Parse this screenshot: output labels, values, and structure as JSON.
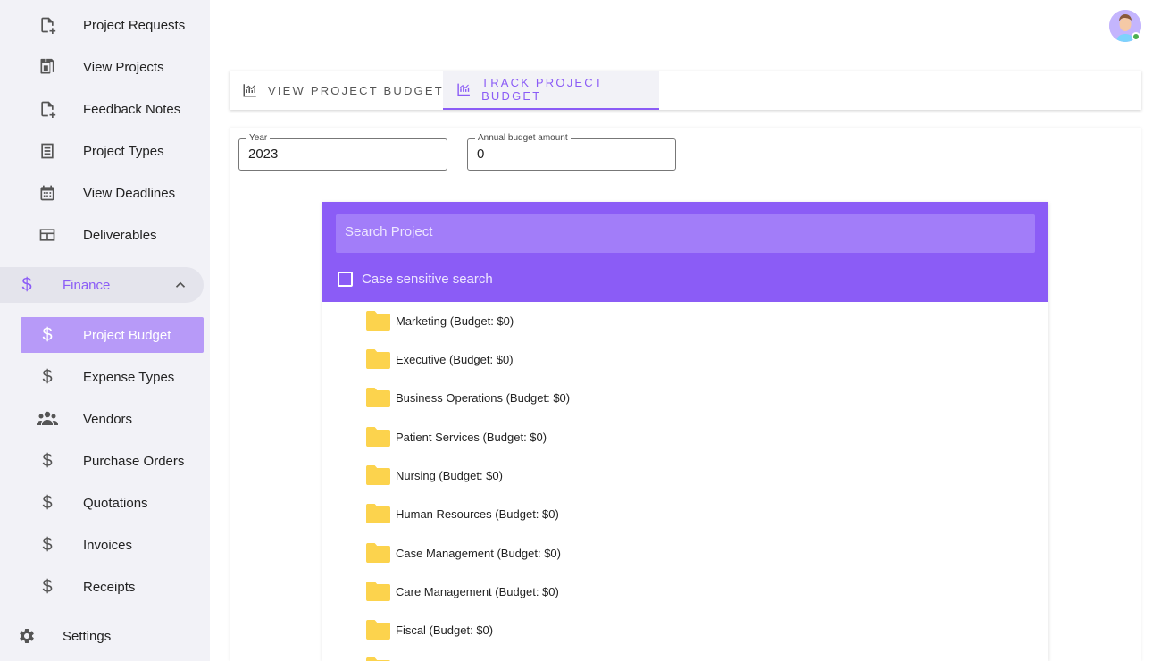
{
  "sidebar": {
    "items": [
      {
        "label": "Project Requests",
        "icon": "file-plus-icon"
      },
      {
        "label": "View Projects",
        "icon": "files-icon"
      },
      {
        "label": "Feedback Notes",
        "icon": "file-plus-icon"
      },
      {
        "label": "Project Types",
        "icon": "list-icon"
      },
      {
        "label": "View Deadlines",
        "icon": "calendar-icon"
      },
      {
        "label": "Deliverables",
        "icon": "table-icon"
      }
    ],
    "finance": {
      "label": "Finance",
      "icon": "dollar-icon",
      "expanded": true
    },
    "finance_items": [
      {
        "label": "Project Budget",
        "icon": "dollar-icon",
        "active": true
      },
      {
        "label": "Expense Types",
        "icon": "dollar-icon"
      },
      {
        "label": "Vendors",
        "icon": "people-icon"
      },
      {
        "label": "Purchase Orders",
        "icon": "dollar-icon"
      },
      {
        "label": "Quotations",
        "icon": "dollar-icon"
      },
      {
        "label": "Invoices",
        "icon": "dollar-icon"
      },
      {
        "label": "Receipts",
        "icon": "dollar-icon"
      }
    ],
    "settings": {
      "label": "Settings",
      "icon": "gear-icon"
    }
  },
  "tabs": [
    {
      "label": "View Project Budgets",
      "icon": "chart-icon",
      "active": false
    },
    {
      "label": "Track Project Budget",
      "icon": "chart-icon",
      "active": true
    }
  ],
  "form": {
    "year": {
      "label": "Year",
      "value": "2023"
    },
    "annual_budget": {
      "label": "Annual budget amount",
      "value": "0"
    }
  },
  "tree": {
    "search_placeholder": "Search Project",
    "case_sensitive_label": "Case sensitive search",
    "case_sensitive_checked": false,
    "items": [
      "Marketing (Budget: $0)",
      "Executive (Budget: $0)",
      "Business Operations (Budget: $0)",
      "Patient Services (Budget: $0)",
      "Nursing (Budget: $0)",
      "Human Resources (Budget: $0)",
      "Case Management (Budget: $0)",
      "Care Management (Budget: $0)",
      "Fiscal (Budget: $0)"
    ]
  },
  "colors": {
    "accent": "#8b5cf6",
    "accent_light": "#b79af8",
    "folder": "#fcd34d",
    "sidebar_bg": "#f2f2f7"
  }
}
